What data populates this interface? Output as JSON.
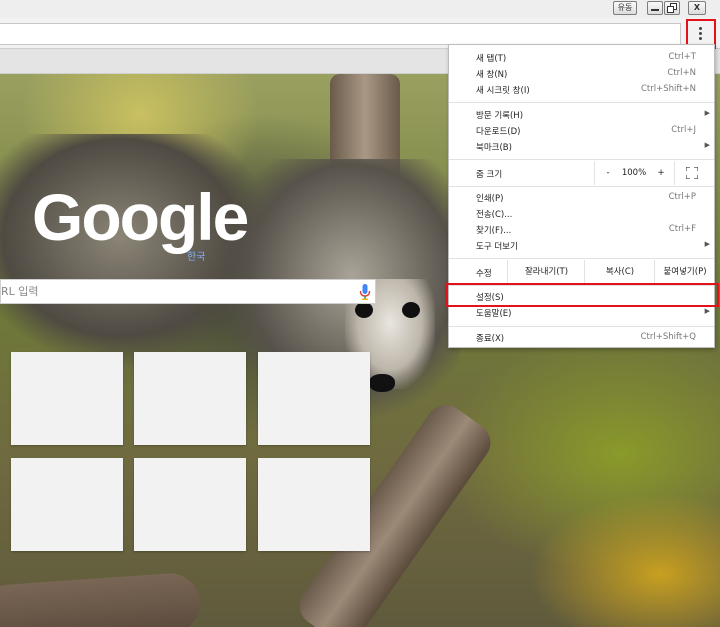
{
  "titlebar": {
    "user_button_label": "유동",
    "minimize_label": "",
    "close_label": "X"
  },
  "ntp": {
    "logo": "Google",
    "logo_region": "한국",
    "search_placeholder": "RL 입력"
  },
  "menu": {
    "items_top": [
      {
        "label": "새 탭(T)",
        "shortcut": "Ctrl+T"
      },
      {
        "label": "새 창(N)",
        "shortcut": "Ctrl+N"
      },
      {
        "label": "새 시크릿 창(I)",
        "shortcut": "Ctrl+Shift+N"
      }
    ],
    "items_history": [
      {
        "label": "방문 기록(H)",
        "shortcut": "",
        "submenu": true
      },
      {
        "label": "다운로드(D)",
        "shortcut": "Ctrl+J"
      },
      {
        "label": "북마크(B)",
        "shortcut": "",
        "submenu": true
      }
    ],
    "zoom": {
      "label": "줌 크기",
      "minus": "-",
      "value": "100%",
      "plus": "+"
    },
    "items_tools": [
      {
        "label": "인쇄(P)",
        "shortcut": "Ctrl+P"
      },
      {
        "label": "전송(C)...",
        "shortcut": ""
      },
      {
        "label": "찾기(F)...",
        "shortcut": "Ctrl+F"
      },
      {
        "label": "도구 더보기",
        "shortcut": "",
        "submenu": true
      }
    ],
    "edit": {
      "label": "수정",
      "cut": "잘라내기(T)",
      "copy": "복사(C)",
      "paste": "붙여넣기(P)"
    },
    "settings": {
      "label": "설정(S)"
    },
    "help": {
      "label": "도움말(E)"
    },
    "exit": {
      "label": "종료(X)",
      "shortcut": "Ctrl+Shift+Q"
    }
  },
  "colors": {
    "highlight": "#e3121a",
    "toolbar": "#f2f2f2"
  }
}
